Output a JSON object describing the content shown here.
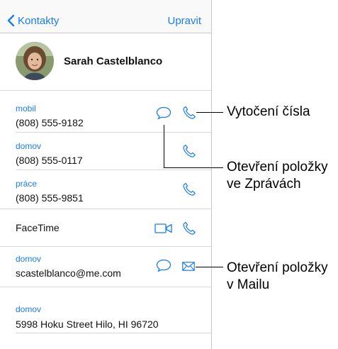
{
  "navbar": {
    "back_label": "Kontakty",
    "edit_label": "Upravit"
  },
  "contact": {
    "name": "Sarah Castelblanco"
  },
  "phones": [
    {
      "label": "mobil",
      "value": "(808) 555-9182"
    },
    {
      "label": "domov",
      "value": "(808) 555-0117"
    },
    {
      "label": "práce",
      "value": "(808) 555-9851"
    }
  ],
  "facetime": {
    "label": "FaceTime"
  },
  "email": {
    "label": "domov",
    "value": "scastelblanco@me.com"
  },
  "address": {
    "label": "domov",
    "value": "5998 Hoku Street Hilo, HI 96720"
  },
  "callouts": {
    "dial": "Vytočení čísla",
    "messages_line1": "Otevření položky",
    "messages_line2": "ve Zprávách",
    "mail_line1": "Otevření položky",
    "mail_line2": "v Mailu"
  },
  "colors": {
    "accent": "#1a7cf5",
    "separator": "#d9d9de"
  }
}
